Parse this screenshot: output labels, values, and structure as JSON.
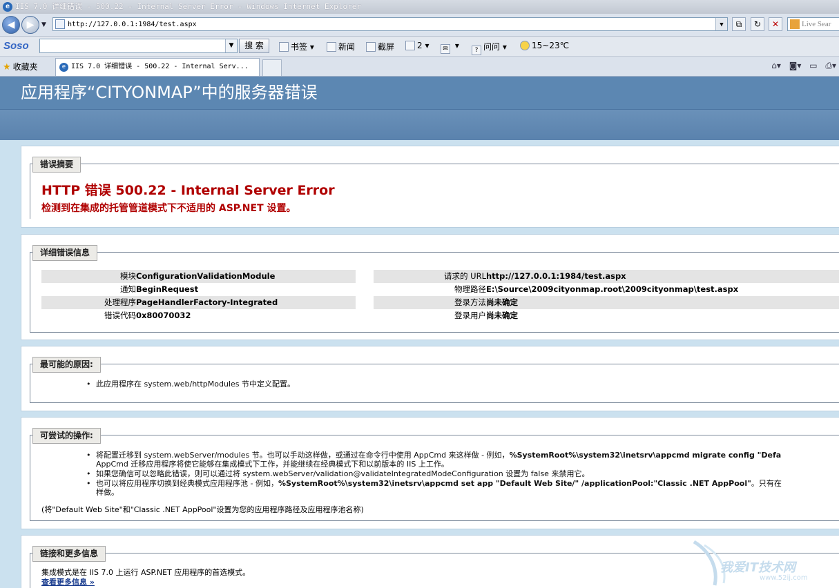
{
  "window": {
    "title": "IIS 7.0 详细错误 - 500.22 - Internal Server Error - Windows Internet Explorer"
  },
  "address_bar": {
    "url": "http://127.0.0.1:1984/test.aspx",
    "search_placeholder": "Live Sear"
  },
  "search_toolbar": {
    "logo": "Soso",
    "search_button": "搜 索",
    "items": [
      {
        "label": "书签",
        "icon": "bookmark-icon"
      },
      {
        "label": "新闻",
        "icon": "news-icon"
      },
      {
        "label": "截屏",
        "icon": "screenshot-icon"
      },
      {
        "label": "2",
        "icon": "weibo-icon"
      },
      {
        "label": "",
        "icon": "mail-icon"
      },
      {
        "label": "问问",
        "icon": "question-icon"
      },
      {
        "label": "15~23℃",
        "icon": "weather-icon"
      }
    ]
  },
  "tabs": {
    "favorites_label": "收藏夹",
    "active_tab": "IIS 7.0 详细错误 - 500.22 - Internal Serv..."
  },
  "page": {
    "header": "应用程序“CITYONMAP”中的服务器错误",
    "summary": {
      "legend": "错误摘要",
      "title": "HTTP 错误 500.22 - Internal Server Error",
      "subtitle": "检测到在集成的托管管道模式下不适用的 ASP.NET 设置。"
    },
    "details": {
      "legend": "详细错误信息",
      "left": [
        {
          "label": "模块",
          "value": "ConfigurationValidationModule"
        },
        {
          "label": "通知",
          "value": "BeginRequest"
        },
        {
          "label": "处理程序",
          "value": "PageHandlerFactory-Integrated"
        },
        {
          "label": "错误代码",
          "value": "0x80070032"
        }
      ],
      "right": [
        {
          "label": "请求的 URL",
          "value": "http://127.0.0.1:1984/test.aspx"
        },
        {
          "label": "物理路径",
          "value": "E:\\Source\\2009cityonmap.root\\2009cityonmap\\test.aspx"
        },
        {
          "label": "登录方法",
          "value": "尚未确定"
        },
        {
          "label": "登录用户",
          "value": "尚未确定"
        }
      ]
    },
    "causes": {
      "legend": "最可能的原因:",
      "items": [
        "此应用程序在 system.web/httpModules 节中定义配置。"
      ]
    },
    "actions": {
      "legend": "可尝试的操作:",
      "items": [
        {
          "prefix": "将配置迁移到 system.webServer/modules 节。也可以手动这样做，或通过在命令行中使用 AppCmd 来这样做 - 例如，",
          "bold": "%SystemRoot%\\system32\\inetsrv\\appcmd migrate config \"Defa",
          "line2": "AppCmd 迁移应用程序将使它能够在集成模式下工作，并能继续在经典模式下和以前版本的 IIS 上工作。"
        },
        {
          "prefix": "如果您确信可以忽略此错误，则可以通过将 system.webServer/validation@validateIntegratedModeConfiguration 设置为 false 来禁用它。",
          "bold": "",
          "line2": ""
        },
        {
          "prefix": "也可以将应用程序切换到经典模式应用程序池 - 例如，",
          "bold": "%SystemRoot%\\system32\\inetsrv\\appcmd set app \"Default Web Site/\" /applicationPool:\"Classic .NET AppPool\"",
          "suffix": "。只有在",
          "line2": "样做。"
        }
      ],
      "note": "(将\"Default Web Site\"和\"Classic .NET AppPool\"设置为您的应用程序路径及应用程序池名称)"
    },
    "links": {
      "legend": "链接和更多信息",
      "text": "集成模式是在 IIS 7.0 上运行 ASP.NET 应用程序的首选模式。",
      "more": "查看更多信息 »"
    }
  },
  "watermark": {
    "text": "我爱IT技术网",
    "url": "www.52ij.com"
  }
}
